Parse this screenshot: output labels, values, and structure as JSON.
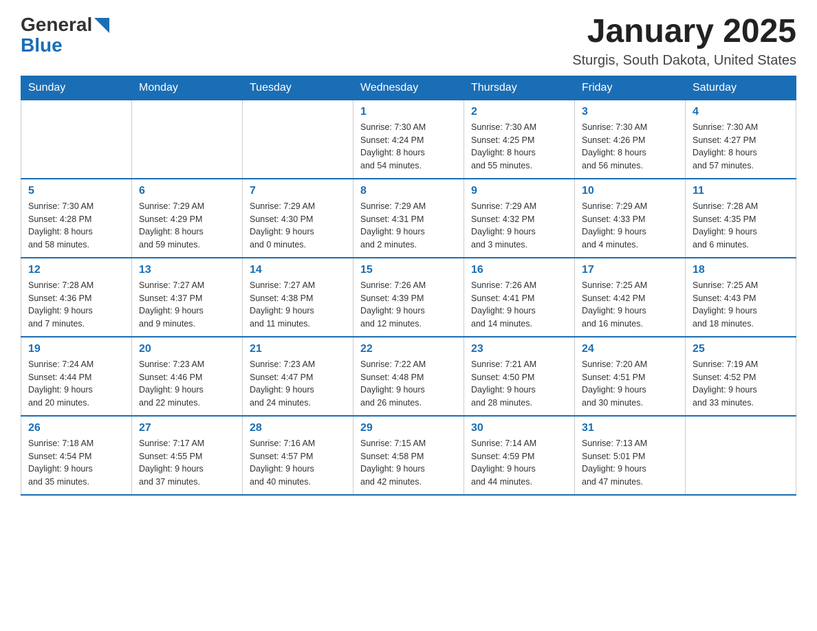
{
  "header": {
    "logo_general": "General",
    "logo_blue": "Blue",
    "title": "January 2025",
    "subtitle": "Sturgis, South Dakota, United States"
  },
  "weekdays": [
    "Sunday",
    "Monday",
    "Tuesday",
    "Wednesday",
    "Thursday",
    "Friday",
    "Saturday"
  ],
  "weeks": [
    [
      {
        "day": "",
        "info": ""
      },
      {
        "day": "",
        "info": ""
      },
      {
        "day": "",
        "info": ""
      },
      {
        "day": "1",
        "info": "Sunrise: 7:30 AM\nSunset: 4:24 PM\nDaylight: 8 hours\nand 54 minutes."
      },
      {
        "day": "2",
        "info": "Sunrise: 7:30 AM\nSunset: 4:25 PM\nDaylight: 8 hours\nand 55 minutes."
      },
      {
        "day": "3",
        "info": "Sunrise: 7:30 AM\nSunset: 4:26 PM\nDaylight: 8 hours\nand 56 minutes."
      },
      {
        "day": "4",
        "info": "Sunrise: 7:30 AM\nSunset: 4:27 PM\nDaylight: 8 hours\nand 57 minutes."
      }
    ],
    [
      {
        "day": "5",
        "info": "Sunrise: 7:30 AM\nSunset: 4:28 PM\nDaylight: 8 hours\nand 58 minutes."
      },
      {
        "day": "6",
        "info": "Sunrise: 7:29 AM\nSunset: 4:29 PM\nDaylight: 8 hours\nand 59 minutes."
      },
      {
        "day": "7",
        "info": "Sunrise: 7:29 AM\nSunset: 4:30 PM\nDaylight: 9 hours\nand 0 minutes."
      },
      {
        "day": "8",
        "info": "Sunrise: 7:29 AM\nSunset: 4:31 PM\nDaylight: 9 hours\nand 2 minutes."
      },
      {
        "day": "9",
        "info": "Sunrise: 7:29 AM\nSunset: 4:32 PM\nDaylight: 9 hours\nand 3 minutes."
      },
      {
        "day": "10",
        "info": "Sunrise: 7:29 AM\nSunset: 4:33 PM\nDaylight: 9 hours\nand 4 minutes."
      },
      {
        "day": "11",
        "info": "Sunrise: 7:28 AM\nSunset: 4:35 PM\nDaylight: 9 hours\nand 6 minutes."
      }
    ],
    [
      {
        "day": "12",
        "info": "Sunrise: 7:28 AM\nSunset: 4:36 PM\nDaylight: 9 hours\nand 7 minutes."
      },
      {
        "day": "13",
        "info": "Sunrise: 7:27 AM\nSunset: 4:37 PM\nDaylight: 9 hours\nand 9 minutes."
      },
      {
        "day": "14",
        "info": "Sunrise: 7:27 AM\nSunset: 4:38 PM\nDaylight: 9 hours\nand 11 minutes."
      },
      {
        "day": "15",
        "info": "Sunrise: 7:26 AM\nSunset: 4:39 PM\nDaylight: 9 hours\nand 12 minutes."
      },
      {
        "day": "16",
        "info": "Sunrise: 7:26 AM\nSunset: 4:41 PM\nDaylight: 9 hours\nand 14 minutes."
      },
      {
        "day": "17",
        "info": "Sunrise: 7:25 AM\nSunset: 4:42 PM\nDaylight: 9 hours\nand 16 minutes."
      },
      {
        "day": "18",
        "info": "Sunrise: 7:25 AM\nSunset: 4:43 PM\nDaylight: 9 hours\nand 18 minutes."
      }
    ],
    [
      {
        "day": "19",
        "info": "Sunrise: 7:24 AM\nSunset: 4:44 PM\nDaylight: 9 hours\nand 20 minutes."
      },
      {
        "day": "20",
        "info": "Sunrise: 7:23 AM\nSunset: 4:46 PM\nDaylight: 9 hours\nand 22 minutes."
      },
      {
        "day": "21",
        "info": "Sunrise: 7:23 AM\nSunset: 4:47 PM\nDaylight: 9 hours\nand 24 minutes."
      },
      {
        "day": "22",
        "info": "Sunrise: 7:22 AM\nSunset: 4:48 PM\nDaylight: 9 hours\nand 26 minutes."
      },
      {
        "day": "23",
        "info": "Sunrise: 7:21 AM\nSunset: 4:50 PM\nDaylight: 9 hours\nand 28 minutes."
      },
      {
        "day": "24",
        "info": "Sunrise: 7:20 AM\nSunset: 4:51 PM\nDaylight: 9 hours\nand 30 minutes."
      },
      {
        "day": "25",
        "info": "Sunrise: 7:19 AM\nSunset: 4:52 PM\nDaylight: 9 hours\nand 33 minutes."
      }
    ],
    [
      {
        "day": "26",
        "info": "Sunrise: 7:18 AM\nSunset: 4:54 PM\nDaylight: 9 hours\nand 35 minutes."
      },
      {
        "day": "27",
        "info": "Sunrise: 7:17 AM\nSunset: 4:55 PM\nDaylight: 9 hours\nand 37 minutes."
      },
      {
        "day": "28",
        "info": "Sunrise: 7:16 AM\nSunset: 4:57 PM\nDaylight: 9 hours\nand 40 minutes."
      },
      {
        "day": "29",
        "info": "Sunrise: 7:15 AM\nSunset: 4:58 PM\nDaylight: 9 hours\nand 42 minutes."
      },
      {
        "day": "30",
        "info": "Sunrise: 7:14 AM\nSunset: 4:59 PM\nDaylight: 9 hours\nand 44 minutes."
      },
      {
        "day": "31",
        "info": "Sunrise: 7:13 AM\nSunset: 5:01 PM\nDaylight: 9 hours\nand 47 minutes."
      },
      {
        "day": "",
        "info": ""
      }
    ]
  ]
}
